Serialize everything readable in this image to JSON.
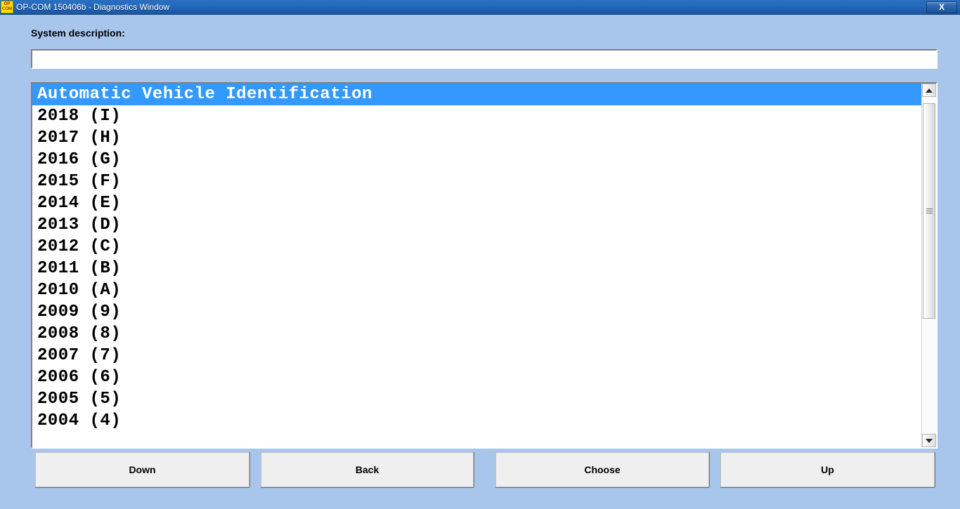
{
  "window": {
    "title": "OP-COM 150406b - Diagnostics Window",
    "logo_line1": "OP",
    "logo_line2": "COM",
    "close_label": "X",
    "titlebar_color": "#1f5fae",
    "background_color": "#a8c6ec"
  },
  "form": {
    "system_description_label": "System description:",
    "system_description_value": "",
    "system_description_placeholder": ""
  },
  "list": {
    "selected_index": 0,
    "highlight_color": "#3399ff",
    "items": [
      {
        "label": "Automatic Vehicle Identification",
        "selected": true
      },
      {
        "label": "2018 (I)",
        "selected": false
      },
      {
        "label": "2017 (H)",
        "selected": false
      },
      {
        "label": "2016 (G)",
        "selected": false
      },
      {
        "label": "2015 (F)",
        "selected": false
      },
      {
        "label": "2014 (E)",
        "selected": false
      },
      {
        "label": "2013 (D)",
        "selected": false
      },
      {
        "label": "2012 (C)",
        "selected": false
      },
      {
        "label": "2011 (B)",
        "selected": false
      },
      {
        "label": "2010 (A)",
        "selected": false
      },
      {
        "label": "2009 (9)",
        "selected": false
      },
      {
        "label": "2008 (8)",
        "selected": false
      },
      {
        "label": "2007 (7)",
        "selected": false
      },
      {
        "label": "2006 (6)",
        "selected": false
      },
      {
        "label": "2005 (5)",
        "selected": false
      },
      {
        "label": "2004 (4)",
        "selected": false
      }
    ]
  },
  "scrollbar": {
    "up_icon": "arrow-up-icon",
    "down_icon": "arrow-down-icon",
    "grip_icon": "grip-lines-icon"
  },
  "buttons": {
    "down": "Down",
    "back": "Back",
    "choose": "Choose",
    "up": "Up"
  }
}
